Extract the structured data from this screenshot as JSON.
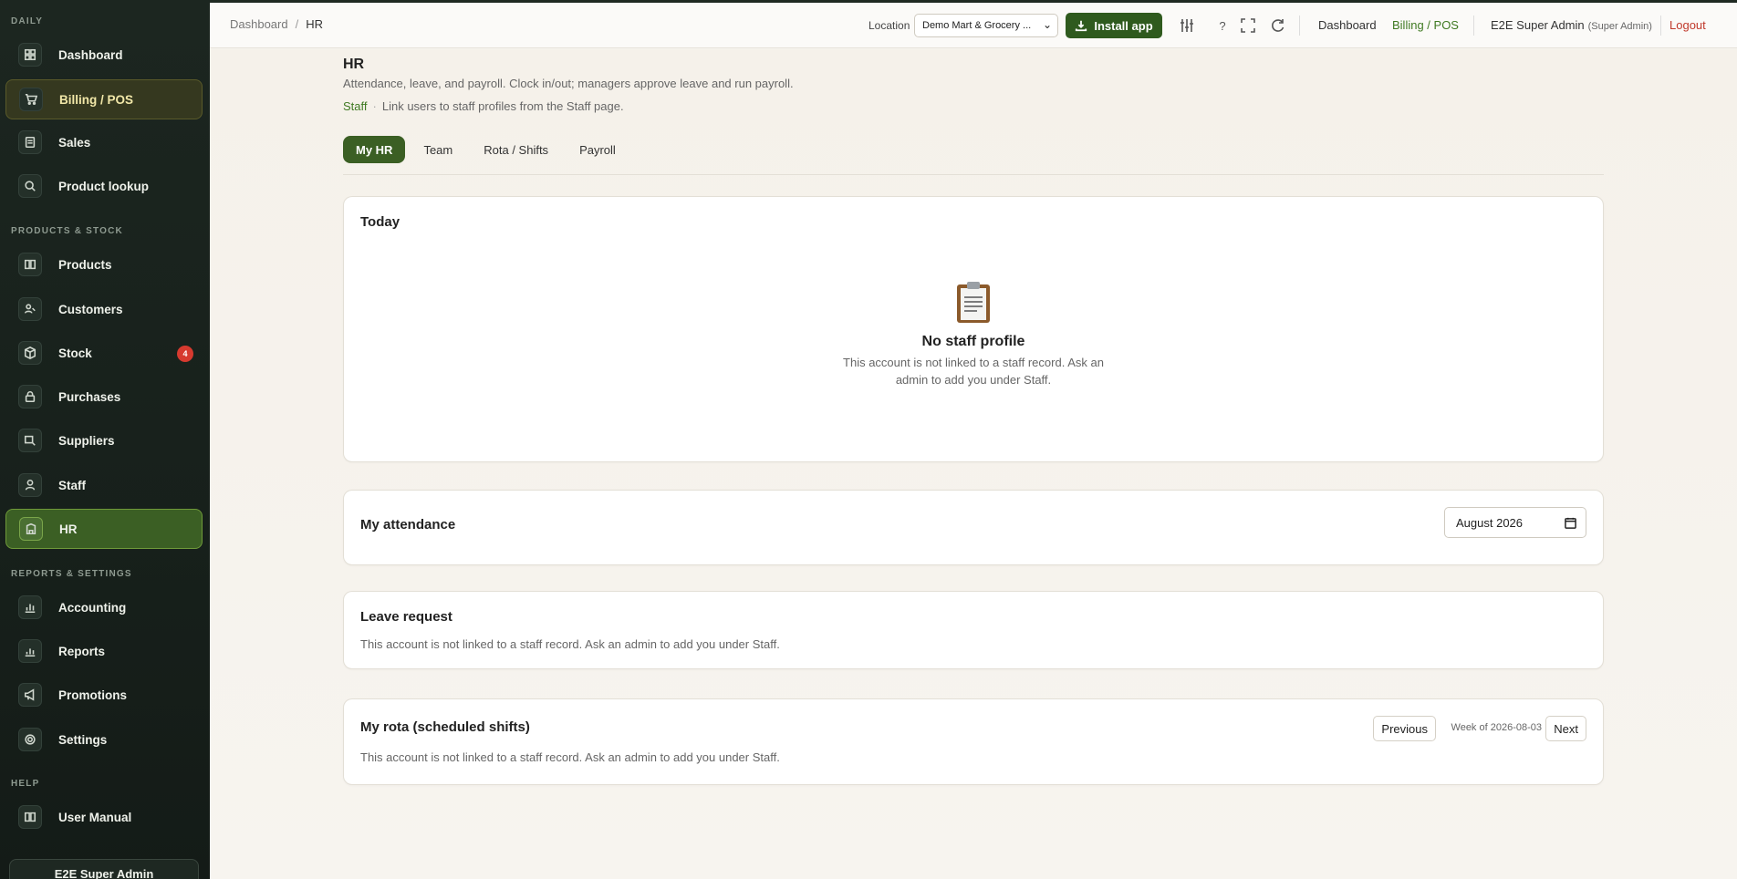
{
  "sidebar": {
    "sections": [
      "DAILY",
      "PRODUCTS & STOCK",
      "REPORTS & SETTINGS",
      "HELP"
    ],
    "items": [
      {
        "label": "Dashboard",
        "icon": "dashboard-icon"
      },
      {
        "label": "Billing / POS",
        "icon": "cart-icon"
      },
      {
        "label": "Sales",
        "icon": "receipt-icon"
      },
      {
        "label": "Product lookup",
        "icon": "search-icon"
      },
      {
        "label": "Products",
        "icon": "book-icon"
      },
      {
        "label": "Customers",
        "icon": "customers-icon"
      },
      {
        "label": "Stock",
        "icon": "box-icon",
        "badge": "4"
      },
      {
        "label": "Purchases",
        "icon": "lock-icon"
      },
      {
        "label": "Suppliers",
        "icon": "supplier-icon"
      },
      {
        "label": "Staff",
        "icon": "person-icon"
      },
      {
        "label": "HR",
        "icon": "building-icon"
      },
      {
        "label": "Accounting",
        "icon": "chart-icon"
      },
      {
        "label": "Reports",
        "icon": "chart-icon"
      },
      {
        "label": "Promotions",
        "icon": "megaphone-icon"
      },
      {
        "label": "Settings",
        "icon": "gear-icon"
      },
      {
        "label": "User Manual",
        "icon": "book-icon"
      }
    ],
    "user_name": "E2E Super Admin"
  },
  "topbar": {
    "breadcrumb": [
      "Dashboard",
      "HR"
    ],
    "location_label": "Location",
    "location_value": "Demo Mart & Grocery ...",
    "install_label": "Install app",
    "help_label": "?",
    "links": [
      "Dashboard",
      "Billing / POS"
    ],
    "user": "E2E Super Admin",
    "role": "(Super Admin)",
    "logout": "Logout"
  },
  "page": {
    "title": "HR",
    "description": "Attendance, leave, and payroll. Clock in/out; managers approve leave and run payroll.",
    "staff_link": "Staff",
    "staff_note": "Link users to staff profiles from the Staff page.",
    "tabs": [
      "My HR",
      "Team",
      "Rota / Shifts",
      "Payroll"
    ]
  },
  "today": {
    "title": "Today",
    "empty_title": "No staff profile",
    "empty_text": "This account is not linked to a staff record. Ask an admin to add you under Staff."
  },
  "attendance": {
    "title": "My attendance",
    "month": "August  2026"
  },
  "leave": {
    "title": "Leave request",
    "text": "This account is not linked to a staff record. Ask an admin to add you under Staff."
  },
  "rota": {
    "title": "My rota (scheduled shifts)",
    "previous": "Previous",
    "week": "Week of 2026-08-03",
    "next": "Next",
    "text": "This account is not linked to a staff record. Ask an admin to add you under Staff."
  },
  "colors": {
    "accent": "#3b5f24",
    "sidebar_bg": "#1c2620",
    "logout": "#c0392b",
    "badge": "#d63a2f"
  }
}
